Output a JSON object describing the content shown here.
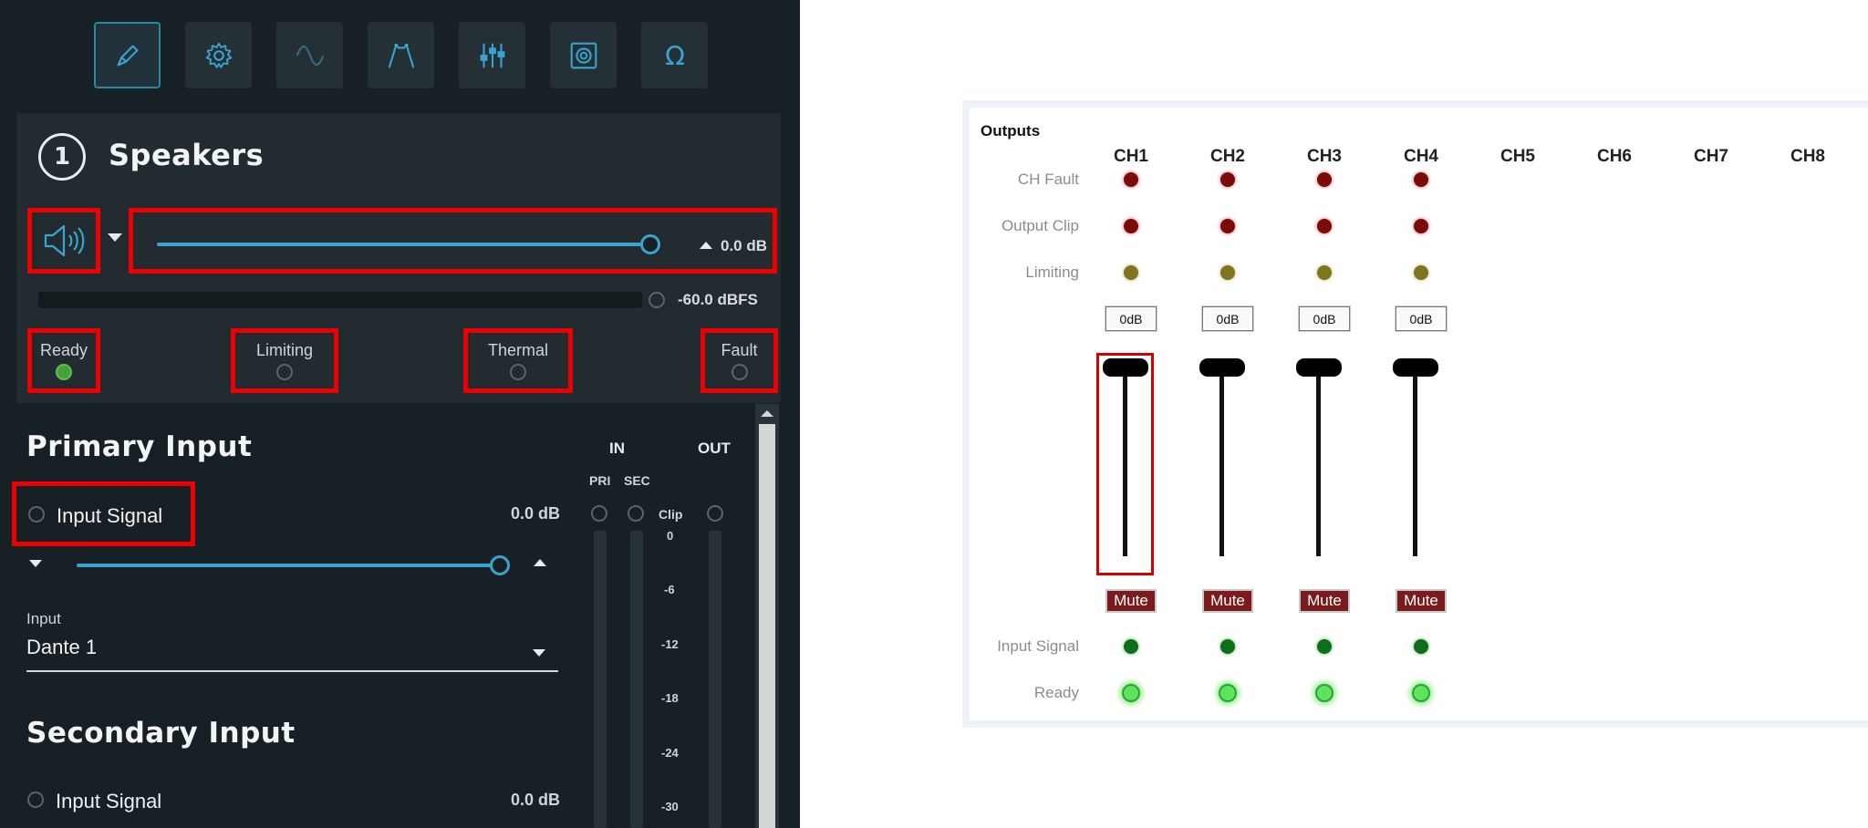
{
  "toolbar": {
    "items": [
      {
        "name": "edit-tool",
        "icon": "pen-icon",
        "active": true
      },
      {
        "name": "settings",
        "icon": "gear-icon"
      },
      {
        "name": "signal",
        "icon": "sine-wave-icon"
      },
      {
        "name": "filter",
        "icon": "filter-curve-icon"
      },
      {
        "name": "eq",
        "icon": "sliders-icon"
      },
      {
        "name": "speaker",
        "icon": "speaker-box-icon"
      },
      {
        "name": "impedance",
        "icon": "omega-icon"
      }
    ]
  },
  "speakers": {
    "number": "1",
    "title": "Speakers",
    "icon": "speaker-volume-icon",
    "volume_value": "0.0 dB",
    "volume_level": 1.0,
    "meter_value": "-60.0 dBFS",
    "indicators": [
      {
        "label": "Ready",
        "on": true
      },
      {
        "label": "Limiting",
        "on": false
      },
      {
        "label": "Thermal",
        "on": false
      },
      {
        "label": "Fault",
        "on": false
      }
    ]
  },
  "primary_input": {
    "title": "Primary Input",
    "signal_label": "Input Signal",
    "signal_value": "0.0 dB",
    "level": 1.0,
    "input_label": "Input",
    "input_value": "Dante 1"
  },
  "meters": {
    "in_label": "IN",
    "out_label": "OUT",
    "pri_label": "PRI",
    "sec_label": "SEC",
    "clip_label": "Clip",
    "scale": [
      "0",
      "-6",
      "-12",
      "-18",
      "-24",
      "-30"
    ]
  },
  "secondary_input": {
    "title": "Secondary Input",
    "signal_label": "Input Signal",
    "signal_value": "0.0 dB"
  },
  "outputs": {
    "title": "Outputs",
    "channels": [
      "CH1",
      "CH2",
      "CH3",
      "CH4",
      "CH5",
      "CH6",
      "CH7",
      "CH8"
    ],
    "row_labels": {
      "ch_fault": "CH Fault",
      "output_clip": "Output Clip",
      "limiting": "Limiting",
      "input_signal": "Input Signal",
      "ready": "Ready"
    },
    "gains": [
      "0dB",
      "0dB",
      "0dB",
      "0dB"
    ],
    "mute_label": "Mute",
    "colors": {
      "fault": "#7b0a0a",
      "limiting": "#7f7420",
      "signal": "#0f6e1a",
      "ready": "#5fe25f",
      "mute": "#7c1b1b"
    }
  }
}
